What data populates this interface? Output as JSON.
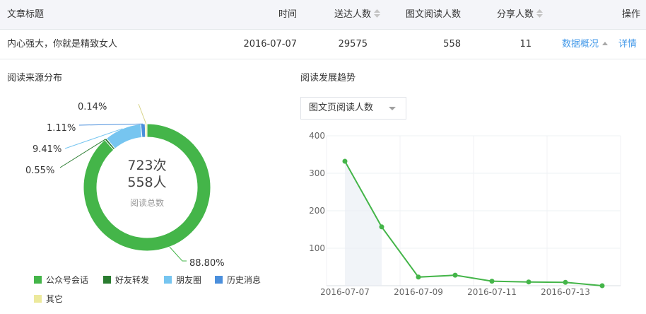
{
  "table": {
    "headers": {
      "title": "文章标题",
      "time": "时间",
      "delivered": "送达人数",
      "reads": "图文阅读人数",
      "shares": "分享人数",
      "actions": "操作"
    },
    "row": {
      "title": "内心强大，你就是精致女人",
      "time": "2016-07-07",
      "delivered": "29575",
      "reads": "558",
      "shares": "11",
      "overview_link": "数据概况",
      "detail_link": "详情"
    }
  },
  "source_section": {
    "title": "阅读来源分布",
    "center_count": "723次",
    "center_people": "558人",
    "center_label": "阅读总数"
  },
  "trend_section": {
    "title": "阅读发展趋势",
    "metric_select": "图文页阅读人数"
  },
  "colors": {
    "green": "#44b549",
    "dark_green": "#2a7c30",
    "light_blue": "#76c5f0",
    "blue": "#4b8fdc",
    "yellow": "#ece99c",
    "link": "#459ae9"
  },
  "chart_data": [
    {
      "type": "pie",
      "donut": true,
      "slices": [
        {
          "name": "公众号会话",
          "value": 88.8,
          "label": "88.80%",
          "color": "#44b549"
        },
        {
          "name": "好友转发",
          "value": 0.55,
          "label": "0.55%",
          "color": "#2a7c30"
        },
        {
          "name": "朋友圈",
          "value": 9.41,
          "label": "9.41%",
          "color": "#76c5f0"
        },
        {
          "name": "历史消息",
          "value": 1.11,
          "label": "1.11%",
          "color": "#4b8fdc"
        },
        {
          "name": "其它",
          "value": 0.14,
          "label": "0.14%",
          "color": "#ece99c"
        }
      ],
      "legend": [
        "公众号会话",
        "好友转发",
        "朋友圈",
        "历史消息",
        "其它"
      ],
      "legend_position": "bottom"
    },
    {
      "type": "line",
      "x": [
        "2016-07-07",
        "2016-07-08",
        "2016-07-09",
        "2016-07-10",
        "2016-07-11",
        "2016-07-12",
        "2016-07-13",
        "2016-07-14"
      ],
      "x_tick_labels": [
        "2016-07-07",
        "2016-07-09",
        "2016-07-11",
        "2016-07-13"
      ],
      "series": [
        {
          "values": [
            332,
            157,
            23,
            28,
            12,
            10,
            9,
            0
          ],
          "color": "#44b549"
        }
      ],
      "y_ticks": [
        100,
        200,
        300,
        400
      ],
      "ylim": [
        0,
        400
      ],
      "grid": true
    }
  ]
}
